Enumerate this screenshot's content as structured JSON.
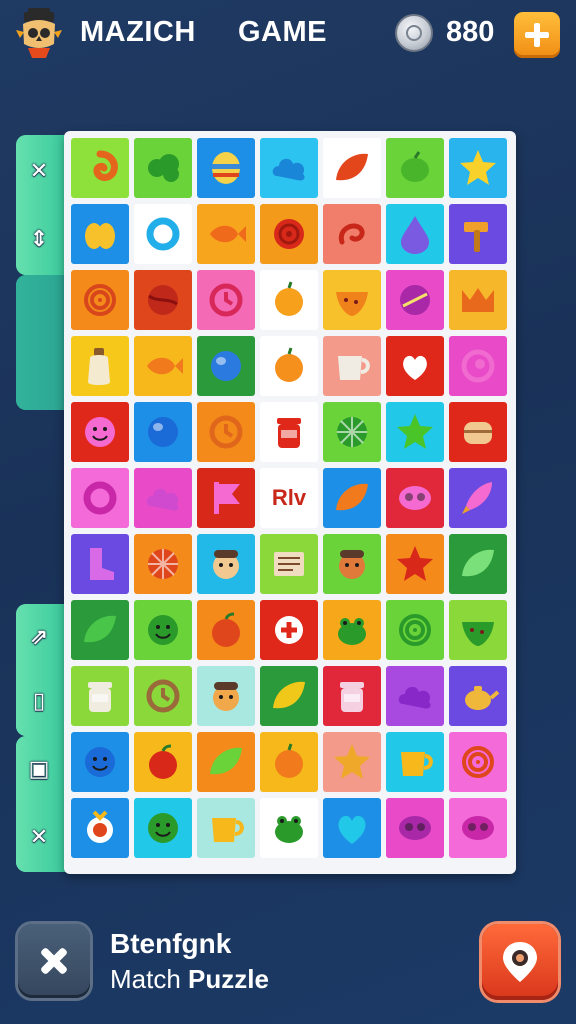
{
  "header": {
    "title_left": "MAZICH",
    "title_right": "GAME",
    "coins": "880",
    "logo_icon": "pirate-skull-icon",
    "coin_icon": "silver-coin-icon",
    "add_icon": "plus-icon"
  },
  "side_buttons": {
    "top": [
      "✕",
      "⇕"
    ],
    "bottom": [
      "⇗",
      "▯",
      "▣",
      "✕"
    ]
  },
  "board": {
    "rows": 11,
    "cols": 7,
    "tiles": [
      [
        {
          "bg": "#8ee03a",
          "icon": "swirl",
          "fg": "#e4661c"
        },
        {
          "bg": "#6bd33a",
          "icon": "bush",
          "fg": "#2a9a2a"
        },
        {
          "bg": "#1d8fe6",
          "icon": "easter-egg",
          "fg": "#f6d14a"
        },
        {
          "bg": "#2cc3f0",
          "icon": "cloud",
          "fg": "#1a86d8"
        },
        {
          "bg": "#ffffff",
          "icon": "leaf",
          "fg": "#e4461c"
        },
        {
          "bg": "#6bd33a",
          "icon": "lemon",
          "fg": "#49b52a"
        },
        {
          "bg": "#29b4ee",
          "icon": "star",
          "fg": "#f8d12a"
        }
      ],
      [
        {
          "bg": "#1d8fe6",
          "icon": "fruit",
          "fg": "#f6c12a"
        },
        {
          "bg": "#ffffff",
          "icon": "ring",
          "fg": "#22aee8"
        },
        {
          "bg": "#f7a51c",
          "icon": "fish",
          "fg": "#f06a1c"
        },
        {
          "bg": "#f49a1a",
          "icon": "rose",
          "fg": "#d8281a"
        },
        {
          "bg": "#f07e6a",
          "icon": "curl",
          "fg": "#c8281a"
        },
        {
          "bg": "#22c8e8",
          "icon": "drop",
          "fg": "#7a5ae0"
        },
        {
          "bg": "#6a4ae0",
          "icon": "hammer",
          "fg": "#f0a02a"
        }
      ],
      [
        {
          "bg": "#f48a1a",
          "icon": "spiral",
          "fg": "#d8461c"
        },
        {
          "bg": "#e0461c",
          "icon": "ball",
          "fg": "#c0281a"
        },
        {
          "bg": "#f46ab4",
          "icon": "clock",
          "fg": "#d8285a"
        },
        {
          "bg": "#ffffff",
          "icon": "orange",
          "fg": "#f6a01c"
        },
        {
          "bg": "#f6c12a",
          "icon": "melon",
          "fg": "#f0821c"
        },
        {
          "bg": "#e84ac8",
          "icon": "plate",
          "fg": "#a828a8"
        },
        {
          "bg": "#f6b82a",
          "icon": "crown",
          "fg": "#e8681c"
        }
      ],
      [
        {
          "bg": "#f6c81a",
          "icon": "bottle",
          "fg": "#f4ead0"
        },
        {
          "bg": "#f6b81a",
          "icon": "fish",
          "fg": "#f07a1c"
        },
        {
          "bg": "#2a9a3a",
          "icon": "globe",
          "fg": "#2a7ae0"
        },
        {
          "bg": "#ffffff",
          "icon": "orange",
          "fg": "#f6901c"
        },
        {
          "bg": "#f49a8a",
          "icon": "cup",
          "fg": "#f0ece4"
        },
        {
          "bg": "#e0281a",
          "icon": "heart-bubble",
          "fg": "#ffffff"
        },
        {
          "bg": "#e84ac8",
          "icon": "shell",
          "fg": "#f06ad0"
        }
      ],
      [
        {
          "bg": "#e0281a",
          "icon": "smile",
          "fg": "#f46ad0"
        },
        {
          "bg": "#1d8fe6",
          "icon": "globe",
          "fg": "#1a6ad8"
        },
        {
          "bg": "#f48a1a",
          "icon": "clock",
          "fg": "#e0661c"
        },
        {
          "bg": "#ffffff",
          "icon": "jar",
          "fg": "#e0281a"
        },
        {
          "bg": "#6bd33a",
          "icon": "wheel",
          "fg": "#2a9a2a"
        },
        {
          "bg": "#22c8e8",
          "icon": "star",
          "fg": "#49c52a"
        },
        {
          "bg": "#e0281a",
          "icon": "barrel",
          "fg": "#f0c890"
        }
      ],
      [
        {
          "bg": "#f46ad8",
          "icon": "ring",
          "fg": "#c828a8"
        },
        {
          "bg": "#e84ac8",
          "icon": "cloud",
          "fg": "#d04ad0"
        },
        {
          "bg": "#d8281a",
          "icon": "flag",
          "fg": "#f46ad0"
        },
        {
          "bg": "#ffffff",
          "icon": "text",
          "fg": "#c8281a",
          "text": "Rlv"
        },
        {
          "bg": "#1d8fe6",
          "icon": "leaf",
          "fg": "#f07a1c"
        },
        {
          "bg": "#e0283a",
          "icon": "mask",
          "fg": "#f46ad0"
        },
        {
          "bg": "#6a4ae0",
          "icon": "rocket",
          "fg": "#f46ad0"
        }
      ],
      [
        {
          "bg": "#6a4ae0",
          "icon": "boot",
          "fg": "#d86ae8"
        },
        {
          "bg": "#f48a1a",
          "icon": "wheel",
          "fg": "#e0461c"
        },
        {
          "bg": "#22b8e8",
          "icon": "face",
          "fg": "#f0c890"
        },
        {
          "bg": "#8ad83a",
          "icon": "book",
          "fg": "#f0dcc0"
        },
        {
          "bg": "#6bd33a",
          "icon": "face",
          "fg": "#e07a3a"
        },
        {
          "bg": "#f48a1a",
          "icon": "star",
          "fg": "#d8281a"
        },
        {
          "bg": "#2a9a3a",
          "icon": "leaf",
          "fg": "#7ae07a"
        }
      ],
      [
        {
          "bg": "#2a9a3a",
          "icon": "leaf",
          "fg": "#49c54a"
        },
        {
          "bg": "#6bd33a",
          "icon": "smile",
          "fg": "#2a9a2a"
        },
        {
          "bg": "#f48a1a",
          "icon": "apple",
          "fg": "#e0461c"
        },
        {
          "bg": "#e0281a",
          "icon": "bone",
          "fg": "#ffffff"
        },
        {
          "bg": "#f6a81a",
          "icon": "frog",
          "fg": "#2a9a2a"
        },
        {
          "bg": "#6bd33a",
          "icon": "spiral",
          "fg": "#2a9a2a"
        },
        {
          "bg": "#8ad83a",
          "icon": "melon",
          "fg": "#2a9a2a"
        }
      ],
      [
        {
          "bg": "#8ad83a",
          "icon": "jar",
          "fg": "#f0ece0"
        },
        {
          "bg": "#8ad83a",
          "icon": "clock",
          "fg": "#9a6a3a"
        },
        {
          "bg": "#a8e8e0",
          "icon": "face",
          "fg": "#f0a84a"
        },
        {
          "bg": "#2a9a3a",
          "icon": "leaf",
          "fg": "#f0c81a"
        },
        {
          "bg": "#e0283a",
          "icon": "jar",
          "fg": "#f4d0e0"
        },
        {
          "bg": "#a84ae0",
          "icon": "cloud",
          "fg": "#8828c8"
        },
        {
          "bg": "#6a4ae0",
          "icon": "teapot",
          "fg": "#f0b83a"
        }
      ],
      [
        {
          "bg": "#1d8fe6",
          "icon": "smile",
          "fg": "#1a6ad8"
        },
        {
          "bg": "#f6b81a",
          "icon": "apple",
          "fg": "#d8281a"
        },
        {
          "bg": "#f48a1a",
          "icon": "leaf",
          "fg": "#6bd33a"
        },
        {
          "bg": "#f6b81a",
          "icon": "orange",
          "fg": "#f07a1c"
        },
        {
          "bg": "#f49a8a",
          "icon": "star",
          "fg": "#f0a82a"
        },
        {
          "bg": "#22c8e8",
          "icon": "cup",
          "fg": "#f6b81a"
        },
        {
          "bg": "#f46ad8",
          "icon": "spiral",
          "fg": "#e0461c"
        }
      ],
      [
        {
          "bg": "#1d8fe6",
          "icon": "medal",
          "fg": "#ffffff"
        },
        {
          "bg": "#22c8e8",
          "icon": "smile",
          "fg": "#2a9a2a"
        },
        {
          "bg": "#a8e8e0",
          "icon": "cup",
          "fg": "#f6b81a"
        },
        {
          "bg": "#ffffff",
          "icon": "frog",
          "fg": "#2a9a2a"
        },
        {
          "bg": "#1d8fe6",
          "icon": "heart",
          "fg": "#22c8e8"
        },
        {
          "bg": "#e84ac8",
          "icon": "mask",
          "fg": "#a828a8"
        },
        {
          "bg": "#f46ad8",
          "icon": "mask",
          "fg": "#c828a8"
        }
      ]
    ]
  },
  "footer": {
    "title": "Btenfgnk",
    "subtitle_plain": "Match ",
    "subtitle_bold": "Puzzle",
    "close_icon": "close-icon",
    "hint_icon": "location-pin-icon"
  }
}
